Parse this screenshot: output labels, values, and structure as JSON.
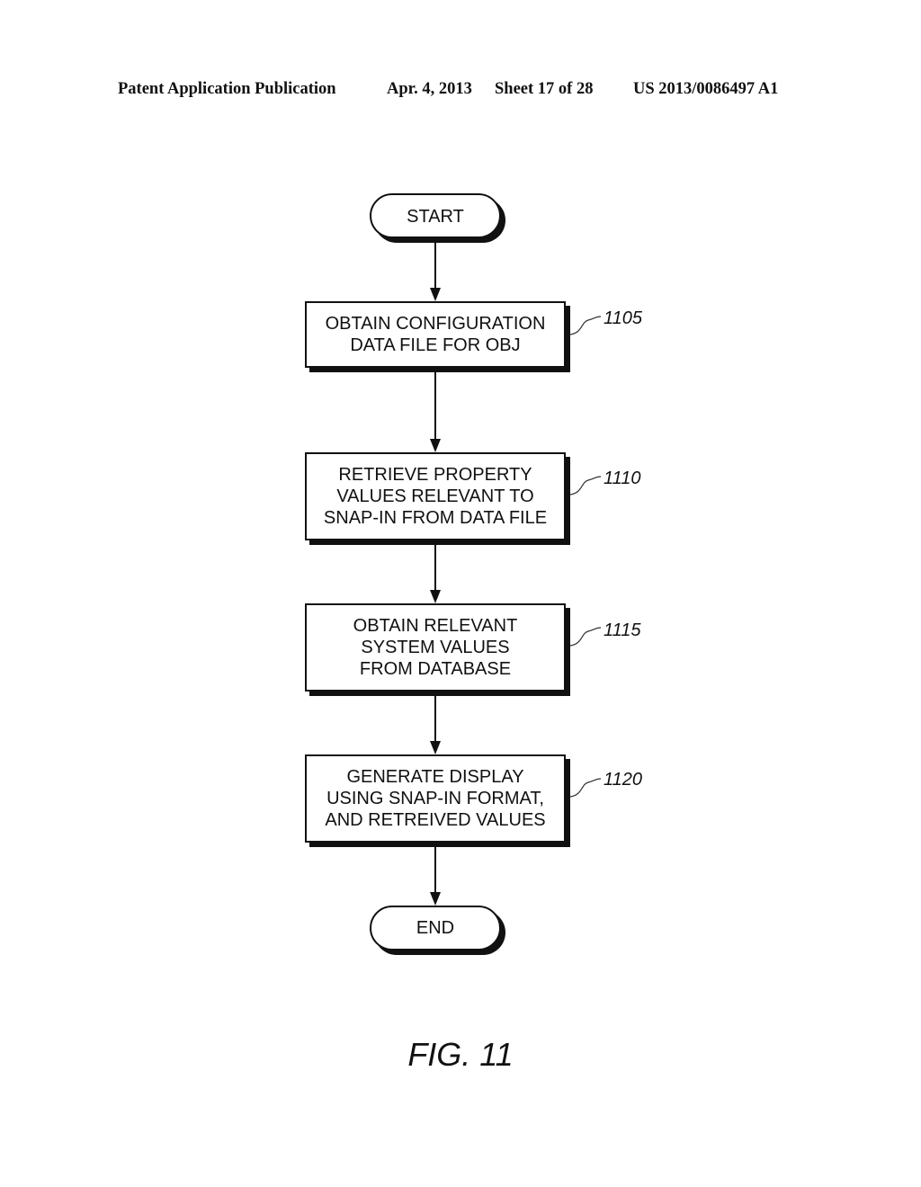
{
  "header": {
    "publication": "Patent Application Publication",
    "date": "Apr. 4, 2013",
    "sheet": "Sheet 17 of 28",
    "patent_number": "US 2013/0086497 A1"
  },
  "flowchart": {
    "start": {
      "label": "START"
    },
    "steps": [
      {
        "ref": "1105",
        "lines": [
          "OBTAIN CONFIGURATION",
          "DATA FILE FOR OBJ"
        ]
      },
      {
        "ref": "1110",
        "lines": [
          "RETRIEVE PROPERTY",
          "VALUES RELEVANT TO",
          "SNAP-IN FROM DATA FILE"
        ]
      },
      {
        "ref": "1115",
        "lines": [
          "OBTAIN RELEVANT",
          "SYSTEM VALUES",
          "FROM DATABASE"
        ]
      },
      {
        "ref": "1120",
        "lines": [
          "GENERATE DISPLAY",
          "USING SNAP-IN FORMAT,",
          "AND RETREIVED VALUES"
        ]
      }
    ],
    "end": {
      "label": "END"
    }
  },
  "figure": {
    "label": "FIG. 11"
  }
}
